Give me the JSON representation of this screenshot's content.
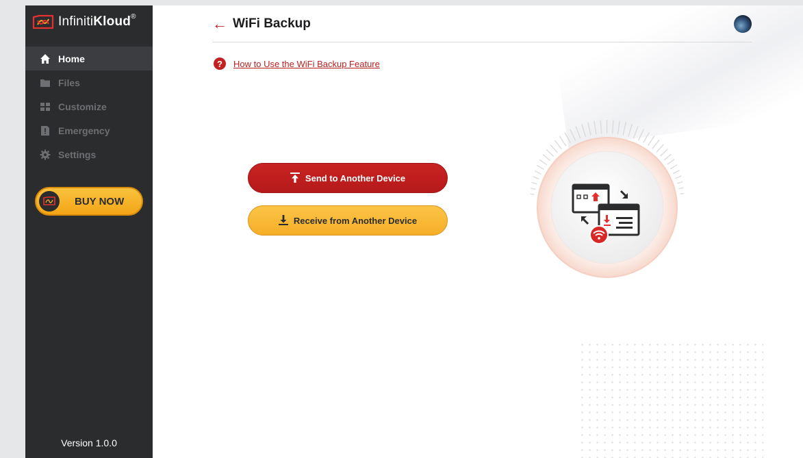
{
  "app": {
    "brand_prefix": "Infiniti",
    "brand_bold": "Kloud",
    "brand_mark": "®",
    "version": "Version 1.0.0"
  },
  "sidebar": {
    "items": [
      {
        "label": "Home",
        "icon": "home-icon",
        "active": true
      },
      {
        "label": "Files",
        "icon": "folder-icon",
        "active": false
      },
      {
        "label": "Customize",
        "icon": "customize-icon",
        "active": false
      },
      {
        "label": "Emergency",
        "icon": "emergency-icon",
        "active": false
      },
      {
        "label": "Settings",
        "icon": "gear-icon",
        "active": false
      }
    ],
    "buy_label": "BUY NOW"
  },
  "header": {
    "back_arrow": "←",
    "title": "WiFi Backup"
  },
  "help": {
    "icon_glyph": "?",
    "link_text": "How to Use the WiFi Backup Feature"
  },
  "actions": {
    "send_label": "Send to Another Device",
    "receive_label": "Receive from Another Device"
  },
  "colors": {
    "accent_red": "#c22121",
    "accent_yellow": "#f6ae29",
    "sidebar_bg": "#2b2c2e"
  }
}
